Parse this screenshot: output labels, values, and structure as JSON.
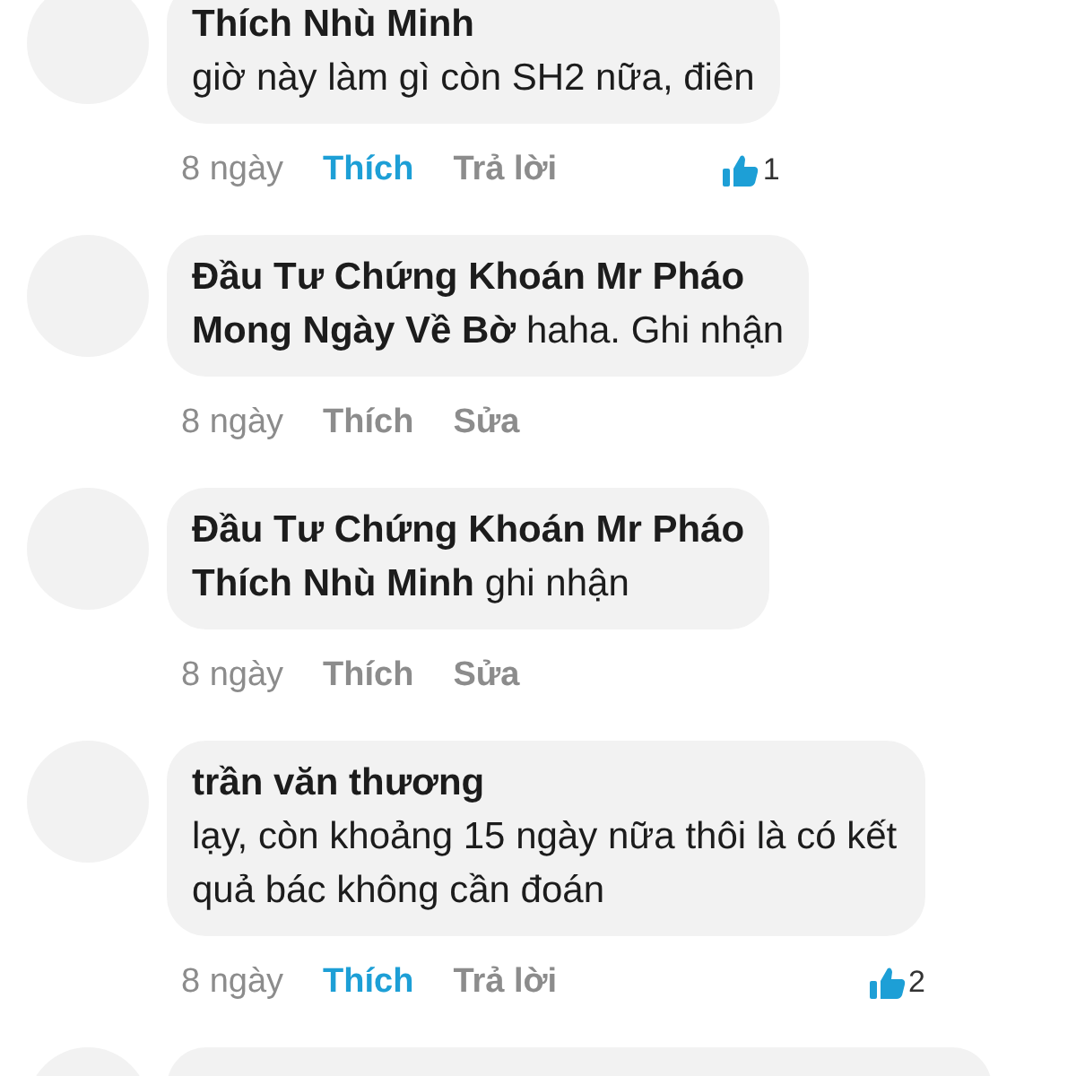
{
  "comments": [
    {
      "author": "Thích Nhù Minh",
      "text": "giờ này làm gì còn SH2 nữa, điên",
      "time": "8 ngày",
      "like": {
        "label": "Thích",
        "selected": true
      },
      "action": "Trả lời",
      "like_count": "1"
    },
    {
      "author": "Đầu Tư Chứng Khoán Mr Pháo",
      "text": "**Mong Ngày Về Bờ**  haha. Ghi nhận",
      "time": "8 ngày",
      "like": {
        "label": "Thích",
        "selected": false
      },
      "action": "Sửa"
    },
    {
      "author": "Đầu Tư Chứng Khoán Mr Pháo",
      "text": "**Thích Nhù Minh**  ghi nhận",
      "time": "8 ngày",
      "like": {
        "label": "Thích",
        "selected": false
      },
      "action": "Sửa"
    },
    {
      "author": "trần văn thương",
      "text": "lạy, còn khoảng 15 ngày nữa thôi là có kết quả bác không cần đoán",
      "time": "8 ngày",
      "like": {
        "label": "Thích",
        "selected": true
      },
      "action": "Trả lời",
      "like_count": "2"
    },
    {
      "kind": "cut"
    }
  ]
}
